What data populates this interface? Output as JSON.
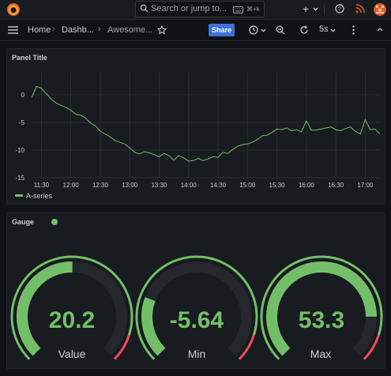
{
  "topbar": {
    "search_placeholder": "Search or jump to...",
    "search_shortcut": "⌘+k",
    "add_label": "+"
  },
  "nav": {
    "breadcrumbs": [
      "Home",
      "Dashb...",
      "Awesome..."
    ],
    "share_label": "Share",
    "refresh_interval": "5s"
  },
  "timeseries_panel": {
    "title": "Panel Title",
    "legend_series": "A-series"
  },
  "gauge_panel": {
    "title": "Gauge",
    "gauges": [
      {
        "label": "Value",
        "display": "20.2",
        "value": 20.2
      },
      {
        "label": "Min",
        "display": "-5.64",
        "value": -5.64
      },
      {
        "label": "Max",
        "display": "53.3",
        "value": 53.3
      }
    ],
    "min": -30,
    "max": 70,
    "threshold": 60
  },
  "colors": {
    "series": "#73bf69",
    "threshold": "#f2495c",
    "primary": "#3d71d9"
  },
  "chart_data": {
    "type": "line",
    "title": "Panel Title",
    "ylim": [
      -15,
      2
    ],
    "y_ticks": [
      "0",
      "-5",
      "-10",
      "-15"
    ],
    "x_ticks": [
      "11:30",
      "12:00",
      "12:30",
      "13:00",
      "13:30",
      "14:00",
      "14:30",
      "15:00",
      "15:30",
      "16:00",
      "16:30",
      "17:00"
    ],
    "series": [
      {
        "name": "A-series",
        "x": [
          "11:20",
          "11:25",
          "11:30",
          "11:35",
          "11:40",
          "11:45",
          "11:50",
          "11:55",
          "12:00",
          "12:05",
          "12:10",
          "12:15",
          "12:20",
          "12:25",
          "12:30",
          "12:35",
          "12:40",
          "12:45",
          "12:50",
          "12:55",
          "13:00",
          "13:05",
          "13:10",
          "13:15",
          "13:20",
          "13:25",
          "13:30",
          "13:35",
          "13:40",
          "13:45",
          "13:50",
          "13:55",
          "14:00",
          "14:05",
          "14:10",
          "14:15",
          "14:20",
          "14:25",
          "14:30",
          "14:35",
          "14:40",
          "14:45",
          "14:50",
          "14:55",
          "15:00",
          "15:05",
          "15:10",
          "15:15",
          "15:20",
          "15:25",
          "15:30",
          "15:35",
          "15:40",
          "15:45",
          "15:50",
          "15:55",
          "16:00",
          "16:05",
          "16:10",
          "16:15",
          "16:20",
          "16:25",
          "16:30",
          "16:35",
          "16:40",
          "16:45",
          "16:50",
          "16:55",
          "17:00",
          "17:05",
          "17:10",
          "17:15"
        ],
        "values": [
          -0.5,
          1.5,
          1.2,
          0.2,
          -0.8,
          -1.5,
          -1.9,
          -2.3,
          -2.8,
          -3.5,
          -3.7,
          -4.2,
          -5.1,
          -5.6,
          -6.6,
          -7.1,
          -7.6,
          -8.3,
          -8.6,
          -8.9,
          -9.6,
          -10.4,
          -10.7,
          -10.3,
          -10.5,
          -10.8,
          -11.2,
          -10.6,
          -11.0,
          -11.8,
          -11.0,
          -11.4,
          -12.0,
          -11.9,
          -11.5,
          -11.9,
          -11.6,
          -11.2,
          -11.3,
          -10.4,
          -10.6,
          -9.9,
          -9.3,
          -9.0,
          -8.9,
          -8.6,
          -8.1,
          -7.4,
          -7.3,
          -6.8,
          -6.2,
          -6.3,
          -6.0,
          -6.5,
          -6.3,
          -6.7,
          -4.7,
          -6.4,
          -6.4,
          -6.2,
          -6.0,
          -5.8,
          -6.3,
          -6.5,
          -6.1,
          -5.8,
          -6.6,
          -7.1,
          -4.5,
          -6.3,
          -6.2,
          -7.1
        ]
      }
    ]
  }
}
